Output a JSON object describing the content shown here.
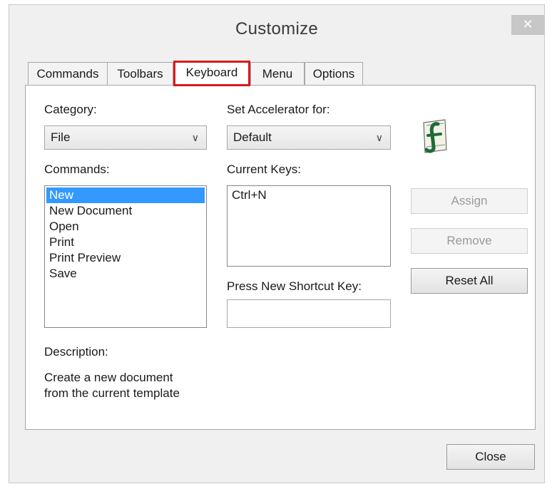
{
  "window": {
    "title": "Customize"
  },
  "tabs": [
    {
      "label": "Commands",
      "active": false
    },
    {
      "label": "Toolbars",
      "active": false
    },
    {
      "label": "Keyboard",
      "active": true
    },
    {
      "label": "Menu",
      "active": false
    },
    {
      "label": "Options",
      "active": false
    }
  ],
  "keyboard": {
    "category_label": "Category:",
    "category_value": "File",
    "commands_label": "Commands:",
    "commands": [
      "New",
      "New Document",
      "Open",
      "Print",
      "Print Preview",
      "Save"
    ],
    "selected_command_index": 0,
    "set_accelerator_label": "Set Accelerator for:",
    "set_accelerator_value": "Default",
    "current_keys_label": "Current Keys:",
    "current_keys": [
      "Ctrl+N"
    ],
    "press_new_label": "Press New Shortcut Key:",
    "press_new_value": "",
    "description_label": "Description:",
    "description_line1": "Create a new document",
    "description_line2": "from the current template",
    "assign_label": "Assign",
    "remove_label": "Remove",
    "reset_all_label": "Reset All"
  },
  "footer": {
    "close_label": "Close"
  },
  "icons": {
    "close": "close-icon",
    "chevron": "chevron-down-icon",
    "app_logo": "app-logo-icon"
  },
  "colors": {
    "highlight": "#d81b1b",
    "selection": "#3399ff"
  }
}
